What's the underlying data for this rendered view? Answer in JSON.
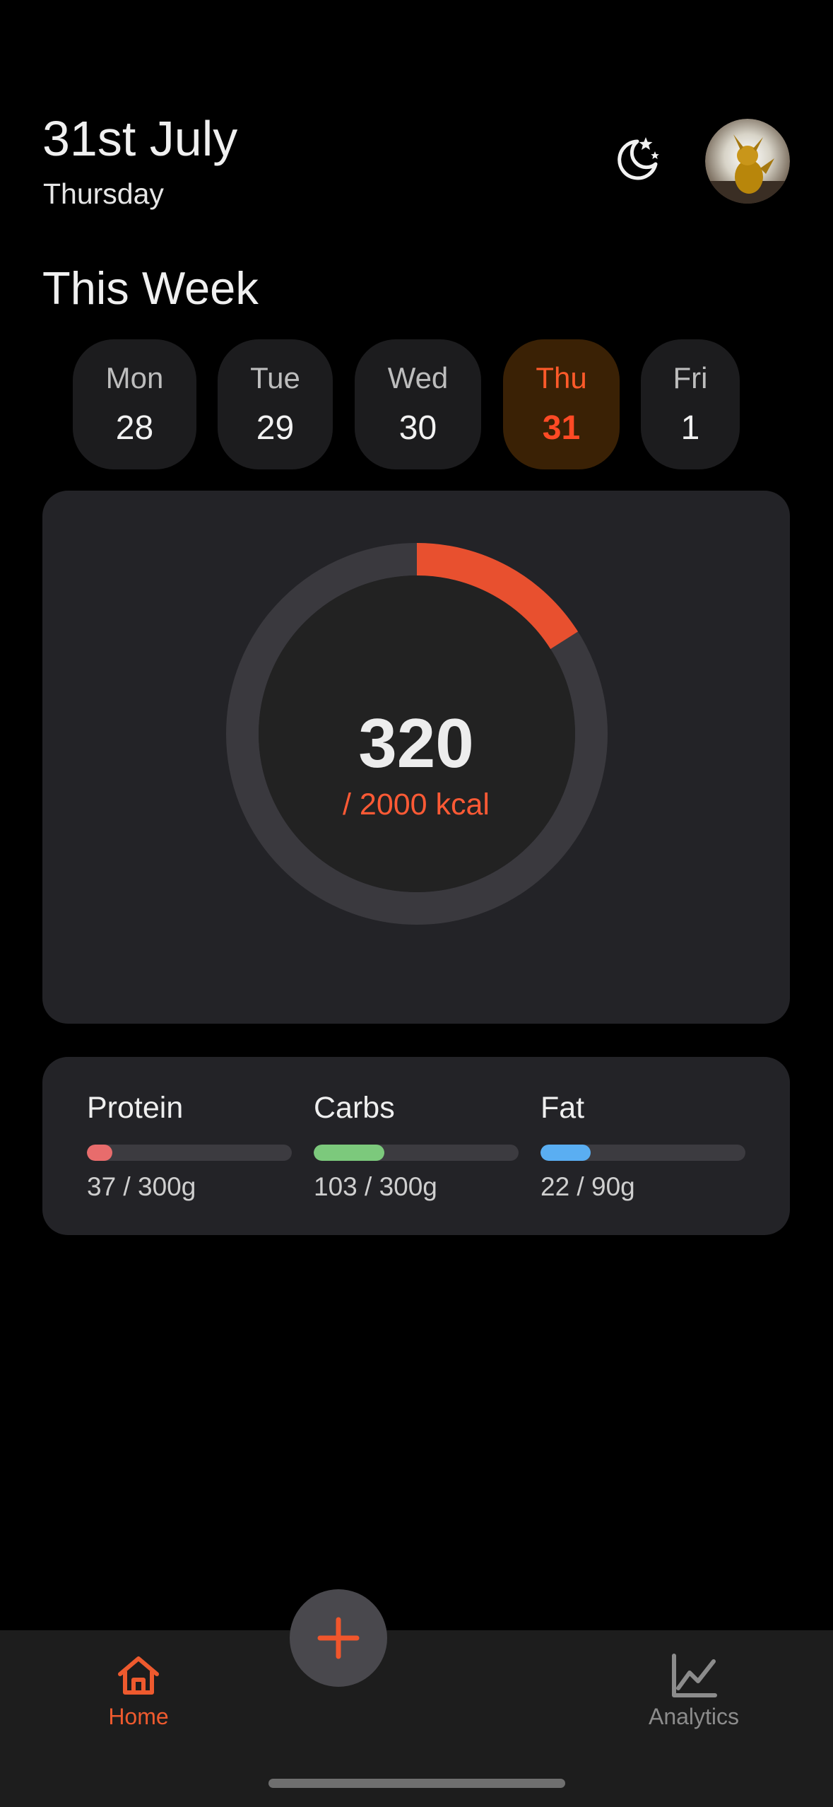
{
  "header": {
    "date": "31st July",
    "weekday": "Thursday",
    "theme_toggle_icon": "moon-stars-icon",
    "avatar_icon": "pikachu-avatar"
  },
  "week": {
    "title": "This Week",
    "days": [
      {
        "name": "Mon",
        "date": "28",
        "active": false
      },
      {
        "name": "Tue",
        "date": "29",
        "active": false
      },
      {
        "name": "Wed",
        "date": "30",
        "active": false
      },
      {
        "name": "Thu",
        "date": "31",
        "active": true
      },
      {
        "name": "Fri",
        "date": "1",
        "active": false
      }
    ]
  },
  "calories": {
    "consumed": "320",
    "goal_label": "/ 2000 kcal",
    "consumed_value": 320,
    "goal_value": 2000,
    "ring_color": "#e8502f",
    "track_color": "#3a393e"
  },
  "macros": [
    {
      "label": "Protein",
      "value_text": "37 / 300g",
      "current": 37,
      "goal": 300,
      "color": "#e86c6c"
    },
    {
      "label": "Carbs",
      "value_text": "103 / 300g",
      "current": 103,
      "goal": 300,
      "color": "#7cc97c"
    },
    {
      "label": "Fat",
      "value_text": "22 / 90g",
      "current": 22,
      "goal": 90,
      "color": "#5aaef2"
    }
  ],
  "nav": {
    "home_label": "Home",
    "home_icon": "home-icon",
    "analytics_label": "Analytics",
    "analytics_icon": "line-chart-icon",
    "add_icon": "plus-icon",
    "active_color": "#ee5a2e",
    "inactive_color": "#8c8c8c"
  }
}
